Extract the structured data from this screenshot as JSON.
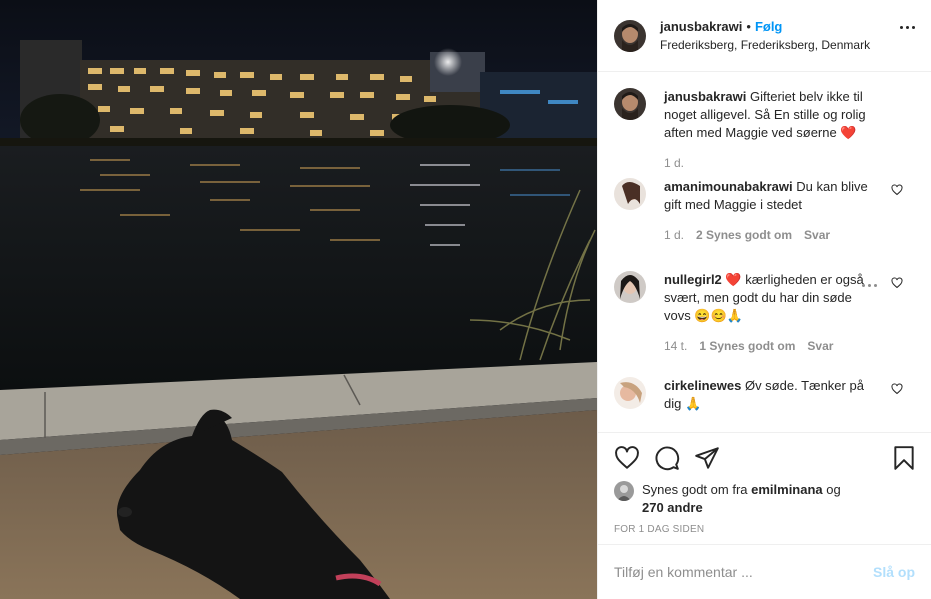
{
  "post": {
    "image_alt": "Night view of a lake with lit apartment buildings and a black dog in the foreground"
  },
  "header": {
    "username": "janusbakrawi",
    "dot": "•",
    "follow_label": "Følg",
    "location": "Frederiksberg, Frederiksberg, Denmark"
  },
  "caption": {
    "username": "janusbakrawi",
    "text": "Gifteriet belv ikke til noget alligevel. Så En stille og rolig aften med Maggie ved søerne",
    "emoji": "❤️",
    "time": "1 d."
  },
  "comments": [
    {
      "username": "amanimounabakrawi",
      "text": "Du kan blive gift med Maggie i stedet",
      "time": "1 d.",
      "likes": "2 Synes godt om",
      "reply": "Svar"
    },
    {
      "username": "nullegirl2",
      "emoji_lead": "❤️",
      "text": "kærligheden er også svært, men godt du har din søde vovs",
      "emoji_tail": "😄😊🙏",
      "time": "14 t.",
      "likes": "1 Synes godt om",
      "reply": "Svar"
    },
    {
      "username": "cirkelinewes",
      "text": "Øv søde. Tænker på dig",
      "emoji_tail": "🙏"
    }
  ],
  "likes": {
    "prefix": "Synes godt om fra",
    "by": "emilminana",
    "and": "og",
    "others": "270 andre"
  },
  "timestamp": "FOR 1 DAG SIDEN",
  "add_comment": {
    "placeholder": "Tilføj en kommentar ...",
    "post_label": "Slå op"
  },
  "colors": {
    "accent": "#0095f6",
    "post_disabled": "#b2dffc",
    "heart": "#ed4956"
  }
}
